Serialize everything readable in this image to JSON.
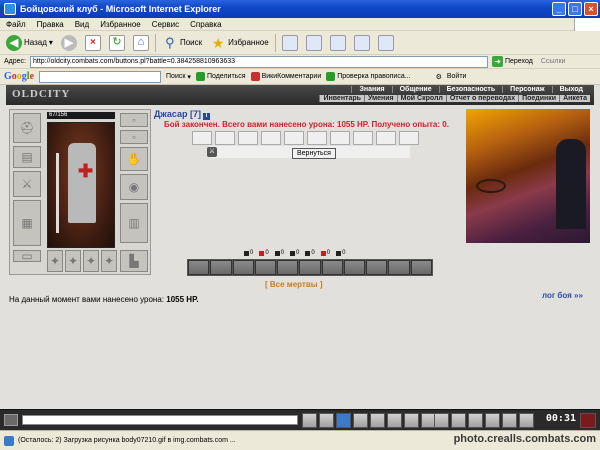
{
  "window": {
    "title": "Бойцовский клуб - Microsoft Internet Explorer"
  },
  "menu": [
    "Файл",
    "Правка",
    "Вид",
    "Избранное",
    "Сервис",
    "Справка"
  ],
  "toolbar": {
    "back_label": "Назад",
    "search_label": "Поиск",
    "favorites_label": "Избранное"
  },
  "address": {
    "label": "Адрес:",
    "url": "http://oldcity.combats.com/buttons.pl?battle=0.384258810963633",
    "go_label": "Переход",
    "links_label": "Ссылки"
  },
  "google": {
    "logo": [
      "G",
      "o",
      "o",
      "g",
      "l",
      "e"
    ],
    "search_label": "Поиск",
    "share_label": "Поделиться",
    "wiki_label": "ВикиКомментарии",
    "spell_label": "Проверка правописа...",
    "login_label": "Войти"
  },
  "game": {
    "logo": "OLDCITY",
    "nav_main": [
      "Знания",
      "Общение",
      "Безопасность",
      "Персонаж",
      "Выход"
    ],
    "nav_sub": [
      "Инвентарь",
      "Умения",
      "Мой Скролл",
      "Отчет о переводах",
      "Поединки",
      "Анкета"
    ],
    "hp_text": "67/156",
    "character_name": "Джасар [7]",
    "info_icon": "i",
    "battle_message": "Бой закончен. Всего вами нанесено урона: 1055 HP. Получено опыта: 0.",
    "return_button": "Вернуться",
    "stats": [
      "0",
      "0",
      "0",
      "0",
      "0",
      "0",
      "0"
    ],
    "all_dead": "[ Все мертвы ]",
    "battle_log": "лог боя »»",
    "damage_text": "На данный момент вами нанесено урона:",
    "damage_value": "1055 HP."
  },
  "chat": {
    "clock": "00:31"
  },
  "status": {
    "text": "(Осталось: 2) Загрузка рисунка body07210.gif в img.combats.com ...",
    "watermark": "photo.crealls.combats.com"
  }
}
